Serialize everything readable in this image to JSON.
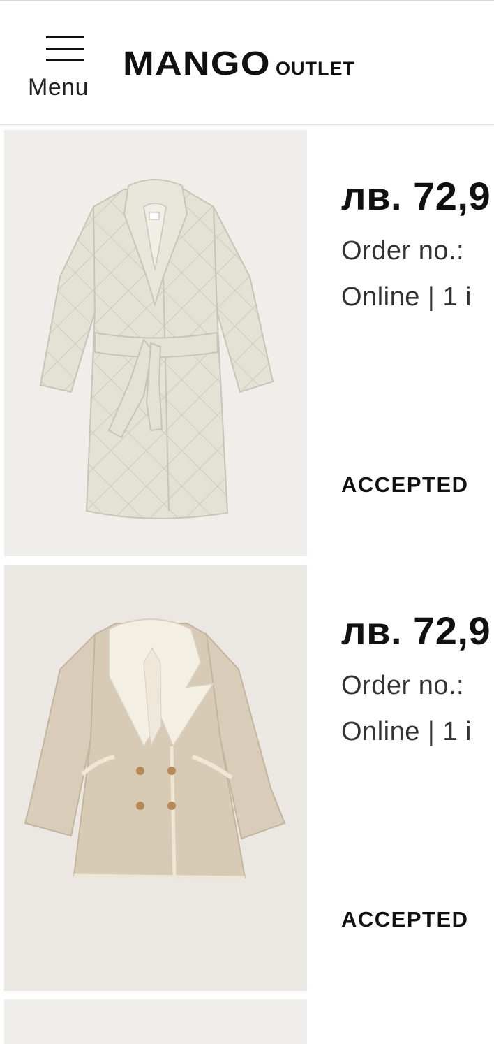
{
  "header": {
    "menu_label": "Menu",
    "logo_main": "MANGO",
    "logo_sub": "OUTLET"
  },
  "orders": [
    {
      "price": "лв. 72,9",
      "order_no_label": "Order no.:",
      "channel": "Online | 1 i",
      "status": "ACCEPTED",
      "image": "quilted-cream-coat"
    },
    {
      "price": "лв. 72,9",
      "order_no_label": "Order no.:",
      "channel": "Online | 1 i",
      "status": "ACCEPTED",
      "image": "beige-shearling-coat"
    }
  ],
  "colors": {
    "text": "#111111",
    "image_bg": "#efeeeb",
    "divider": "#dedede"
  }
}
